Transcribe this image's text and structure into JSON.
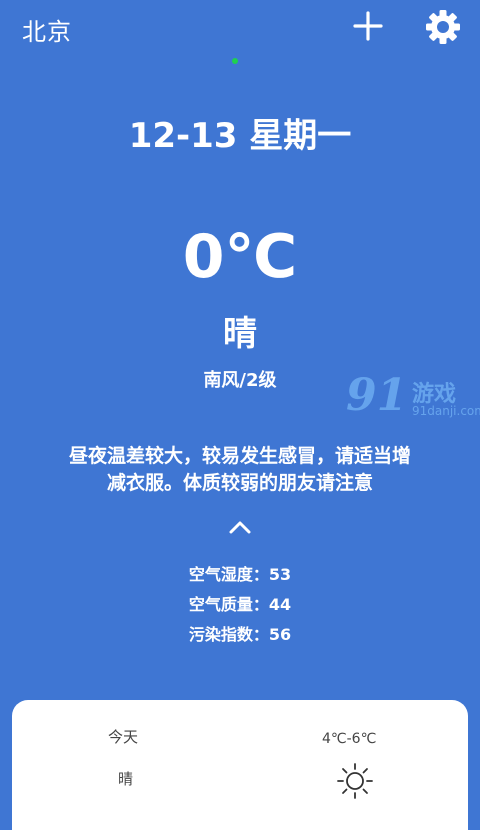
{
  "header": {
    "city": "北京"
  },
  "main": {
    "date": "12-13 星期一",
    "temperature": "0℃",
    "condition": "晴",
    "wind": "南风/2级",
    "advice": "昼夜温差较大，较易发生感冒，请适当增减衣服。体质较弱的朋友请注意",
    "stats": [
      {
        "label": "空气湿度：",
        "value": "53"
      },
      {
        "label": "空气质量：",
        "value": "44"
      },
      {
        "label": "污染指数：",
        "value": "56"
      }
    ]
  },
  "forecast": {
    "day": "今天",
    "condition": "晴",
    "range": "4℃-6℃",
    "icon": "sun-icon"
  },
  "watermark": {
    "logo": "91",
    "title": "游戏",
    "url": "91danji.com"
  },
  "colors": {
    "background": "#3f76d3",
    "card": "#ffffff",
    "indicator": "#1fd14f"
  }
}
